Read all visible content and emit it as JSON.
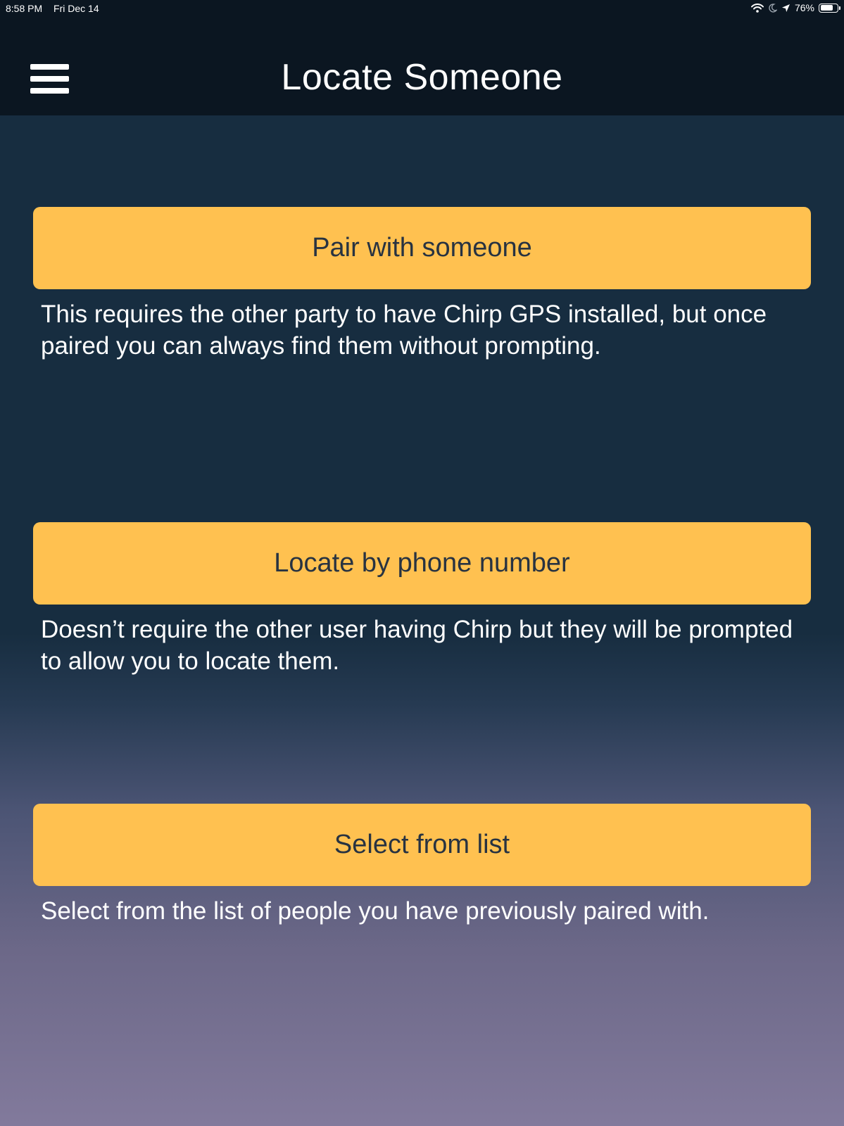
{
  "status_bar": {
    "time": "8:58 PM",
    "date": "Fri Dec 14",
    "battery_percent": "76%",
    "battery_level": 0.76,
    "icons": [
      "wifi-icon",
      "moon-icon",
      "location-arrow-icon",
      "battery-icon"
    ]
  },
  "header": {
    "title": "Locate Someone",
    "menu_icon": "hamburger-menu-icon"
  },
  "options": [
    {
      "label": "Pair with someone",
      "description": "This requires the other party to have Chirp GPS installed, but once paired you can always find them without prompting."
    },
    {
      "label": "Locate by phone number",
      "description": "Doesn’t require the other user having Chirp but they will be prompted to allow you to locate them."
    },
    {
      "label": "Select from list",
      "description": "Select from the list of people you have previously paired with."
    }
  ],
  "colors": {
    "header_background": "#0b1621",
    "button_background": "#ffc150",
    "button_text": "#283341",
    "gradient_top": "#172d40",
    "gradient_bottom": "#827a9c"
  }
}
